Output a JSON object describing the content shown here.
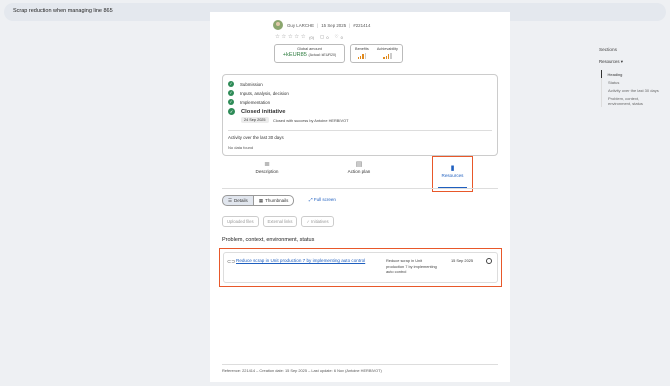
{
  "topbar": {
    "title": "Scrap reduction when managing line 865"
  },
  "meta": {
    "author": "Guy LARCHE",
    "date": "15 Sep 2025",
    "id_icon": "#",
    "id": "221414"
  },
  "rating": {
    "stars": "☆☆☆☆☆",
    "count": "(0)",
    "comments": "0",
    "likes": "0"
  },
  "amount": {
    "label": "Global amount",
    "value": "+kEUR85",
    "actual": "(Actual: kEUR20)"
  },
  "benefits": {
    "label": "Benefits",
    "achievability_label": "Achievability",
    "benefits_level": 0.6,
    "achievability_level": 0.6,
    "bar_color": "#e08a1e"
  },
  "status": {
    "steps": [
      "Submission",
      "Inputs, analysis, decision",
      "Implementation"
    ],
    "current": "Closed initiative",
    "date": "24 Sep 2025",
    "closed_text": "Closed with success by Antoine HERBIVOT",
    "activity_title": "Activity over the last 30 days",
    "no_data": "No data found"
  },
  "tabs": [
    {
      "label": "Description",
      "icon": "description-icon"
    },
    {
      "label": "Action plan",
      "icon": "clipboard-icon"
    },
    {
      "label": "Resources",
      "icon": "document-icon",
      "active": true
    }
  ],
  "view": {
    "details": "Details",
    "thumbnails": "Thumbnails",
    "fullscreen": "Full screen"
  },
  "filters": [
    "Uploaded files",
    "External links",
    "Initiatives"
  ],
  "section": {
    "title": "Problem, context, environment, status"
  },
  "resource": {
    "link": "Reduce scrap in Unit production 7 by implementing auto control",
    "description": "Reduce scrap in Unit production 7 by implementing auto control",
    "date": "15 Sep 2025"
  },
  "footer": {
    "text": "Reference: 221414 – Creation date: 15 Sep 2025 – Last update: 6 Nov (Antoine HERBIVOT)"
  },
  "sidebar": {
    "title": "Sections",
    "dropdown": "Resources",
    "items": [
      "Heading",
      "Status",
      "Activity over the last 30 days",
      "Problem, context, environment, status"
    ]
  },
  "colors": {
    "accent": "#1f5fbf",
    "highlight": "#e8582a",
    "success": "#2e8b57"
  }
}
